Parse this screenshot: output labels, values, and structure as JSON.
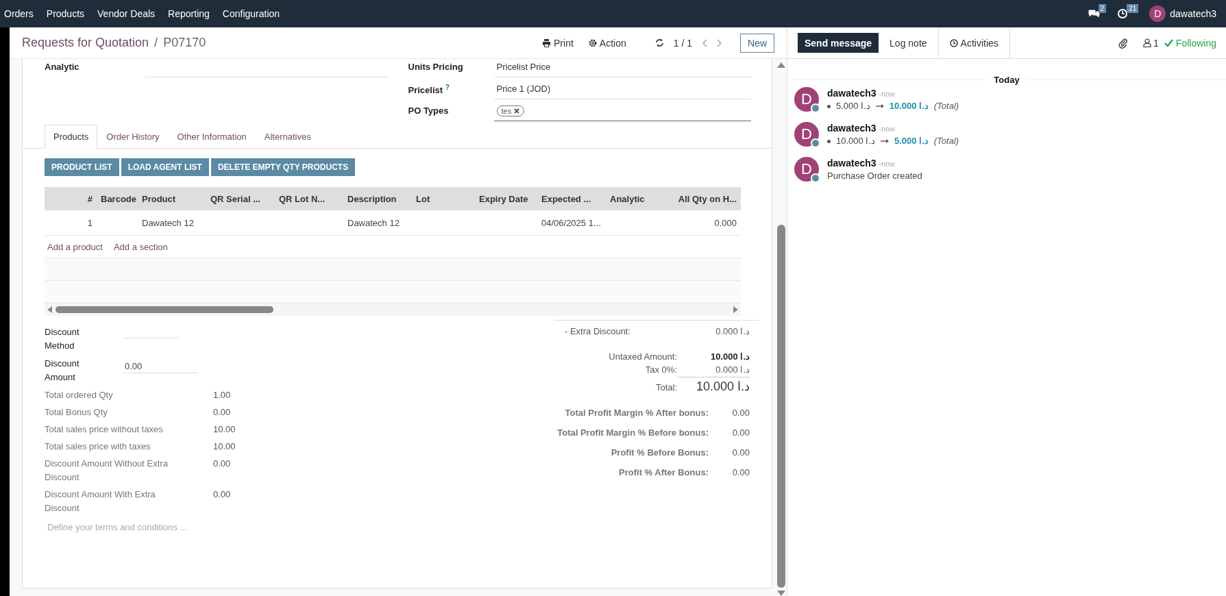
{
  "navbar": {
    "menu": [
      "Orders",
      "Products",
      "Vendor Deals",
      "Reporting",
      "Configuration"
    ],
    "messages_count": "2",
    "activities_count": "21",
    "user_initial": "D",
    "user_name": "dawatech3"
  },
  "breadcrumb": {
    "parent": "Requests for Quotation",
    "separator": "/",
    "current": "P07170"
  },
  "control": {
    "print": "Print",
    "action": "Action",
    "pager": "1 / 1",
    "new": "New"
  },
  "left_fields": [
    {
      "label": "Analytic"
    }
  ],
  "right_fields": [
    {
      "kind": "text",
      "label": "Units Pricing",
      "value": "Pricelist Price"
    },
    {
      "kind": "text",
      "label": "Pricelist",
      "help": "?",
      "value": "Price 1 (JOD)"
    },
    {
      "kind": "tags",
      "label": "PO Types",
      "tags": [
        "tes"
      ]
    }
  ],
  "tabs": [
    {
      "label": "Products",
      "selected": true
    },
    {
      "label": "Order History",
      "selected": false
    },
    {
      "label": "Other Information",
      "selected": false
    },
    {
      "label": "Alternatives",
      "selected": false
    }
  ],
  "action_buttons": [
    "PRODUCT LIST",
    "LOAD AGENT LIST",
    "DELETE EMPTY QTY PRODUCTS"
  ],
  "table": {
    "columns": [
      "#",
      "Barcode",
      "Product",
      "QR Serial ...",
      "QR Lot N...",
      "Description",
      "Lot",
      "Expiry Date",
      "Expected ...",
      "Analytic",
      "All Qty on H..."
    ],
    "rows": [
      [
        "1",
        null,
        "Dawatech 12",
        null,
        null,
        "Dawatech 12",
        null,
        null,
        "04/06/2025 1...",
        null,
        "0.000"
      ]
    ],
    "add_links": [
      "Add a product",
      "Add a section"
    ]
  },
  "discount_fields": [
    {
      "label": "Discount Method"
    },
    {
      "label": "Discount Amount",
      "value": "0.00"
    }
  ],
  "summary": [
    {
      "label": "Total ordered Qty",
      "value": "1.00"
    },
    {
      "label": "Total Bonus Qty",
      "value": "0.00"
    },
    {
      "label": "Total sales price without taxes",
      "value": "10.00"
    },
    {
      "label": "Total sales price with taxes",
      "value": "10.00"
    },
    {
      "label": "Discount Amount Without Extra Discount",
      "value": "0.00"
    },
    {
      "label": "Discount Amount With Extra Discount",
      "value": "0.00"
    }
  ],
  "terms_placeholder": "Define your terms and conditions ...",
  "totals": [
    {
      "kind": "extra",
      "label": "- Extra Discount:",
      "value": "0.000 د.ا"
    },
    {
      "kind": "untaxed",
      "label": "Untaxed Amount:",
      "value": "10.000 د.ا"
    },
    {
      "kind": "tax",
      "label": "Tax 0%:",
      "value": "0.000 د.ا"
    },
    {
      "kind": "total",
      "label": "Total:",
      "value": "10.000 د.ا"
    }
  ],
  "profits": [
    {
      "label": "Total Profit Margin % After bonus:",
      "value": "0.00"
    },
    {
      "label": "Total Profit Margin % Before bonus:",
      "value": "0.00"
    },
    {
      "label": "Profit % Before Bonus:",
      "value": "0.00"
    },
    {
      "label": "Profit % After Bonus:",
      "value": "0.00"
    }
  ],
  "chatter": {
    "buttons": [
      {
        "label": "Send message",
        "selected": true
      },
      {
        "label": "Log note",
        "selected": false
      }
    ],
    "activities": "Activities",
    "followers_count": "1",
    "following": "Following",
    "date": "Today",
    "messages": [
      {
        "kind": "change",
        "initial": "D",
        "author": "dawatech3",
        "time": "-now",
        "old": "5.000 د.ا",
        "new": "10.000 د.ا",
        "field": "(Total)"
      },
      {
        "kind": "change",
        "initial": "D",
        "author": "dawatech3",
        "time": "-now",
        "old": "10.000 د.ا",
        "new": "5.000 د.ا",
        "field": "(Total)"
      },
      {
        "kind": "text",
        "initial": "D",
        "author": "dawatech3",
        "time": "-now",
        "body": "Purchase Order created"
      }
    ]
  }
}
